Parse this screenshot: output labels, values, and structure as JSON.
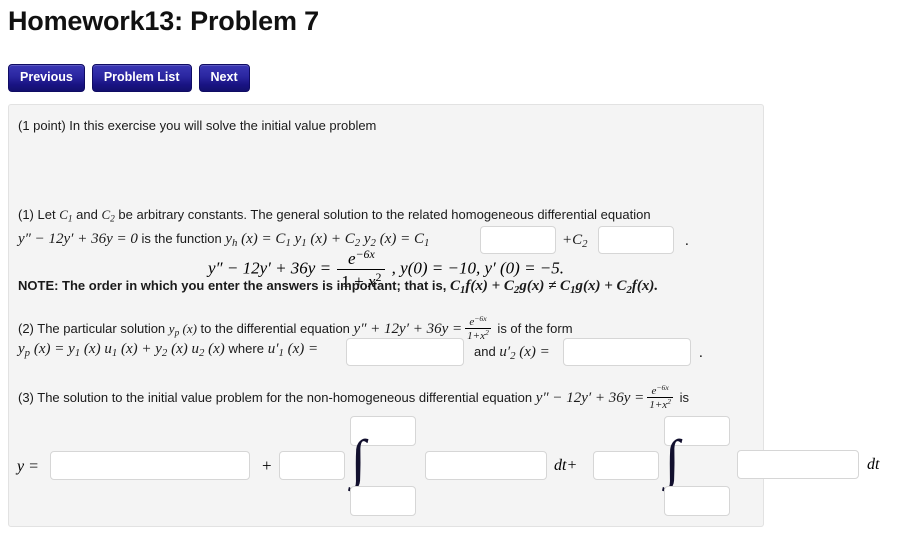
{
  "header": {
    "title": "Homework13: Problem 7"
  },
  "nav": {
    "buttons": [
      {
        "label": "Previous",
        "name": "previous-button"
      },
      {
        "label": "Problem List",
        "name": "problem-list-button"
      },
      {
        "label": "Next",
        "name": "next-button"
      }
    ]
  },
  "problem": {
    "points_line": "(1 point) In this exercise you will solve the initial value problem",
    "main_equation": {
      "lhs": "y″ − 12y′ + 36y =",
      "rhs_numerator": "e−6x",
      "rhs_denominator": "1 + x2",
      "initial_conditions": ",  y(0) = −10,  y′ (0) = −5."
    },
    "part1": {
      "line1_a": "(1) Let ",
      "line1_c1": "C1",
      "line1_b": " and ",
      "line1_c2": "C2",
      "line1_c": " be arbitrary constants. The general solution to the related homogeneous differential equation",
      "line2_eq": "y″ − 12y′ + 36y = 0",
      "line2_text": " is the function ",
      "line2_yh": "yh (x) = C1 y1 (x) + C2 y2 (x) = C1",
      "mid_label": "+C2",
      "end_period": ".",
      "input1_value": "",
      "input2_value": ""
    },
    "note": {
      "prefix": "NOTE: The order in which you enter the answers is important; that is, ",
      "expression": "C1f(x) + C2g(x) ≠ C1g(x) + C2f(x)."
    },
    "part2": {
      "line1_a": "(2) The particular solution ",
      "line1_yp": "yp (x)",
      "line1_b": " to the differential equation ",
      "line1_eq": "y″ + 12y′ + 36y =",
      "frac_num": "e−6x",
      "frac_den": "1+x2",
      "line1_c": " is of the form",
      "line2_a": "yp (x) = y1 (x) u1 (x) + y2 (x) u2 (x) where u′1 (x) =",
      "line2_b": "and u′2 (x) =",
      "end_period": ".",
      "input1_value": "",
      "input2_value": ""
    },
    "part3": {
      "line1_a": "(3) The solution to the initial value problem for the non-homogeneous differential equation ",
      "line1_eq": "y″ − 12y′ + 36y =",
      "frac_num": "e−6x",
      "frac_den": "1+x2",
      "line1_b": " is",
      "answer_row": {
        "y_label": "y =",
        "plus_label": "+",
        "dt_plus_label": "dt+",
        "dt_label": "dt",
        "integral_glyph": "∫",
        "main_value": "",
        "coef1_value": "",
        "upper1_value": "",
        "lower1_value": "",
        "integrand1_value": "",
        "coef2_value": "",
        "upper2_value": "",
        "lower2_value": "",
        "integrand2_value": ""
      }
    }
  }
}
